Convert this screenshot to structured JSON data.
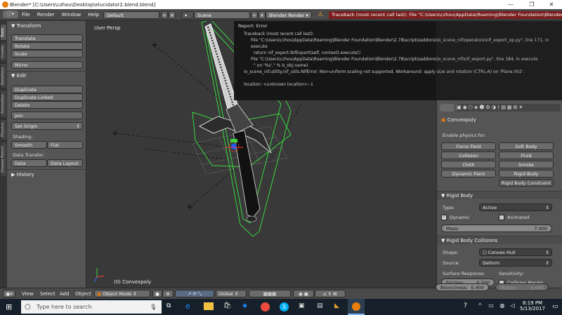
{
  "window": {
    "title": "Blender* [C:\\Users\\czhou\\Desktop\\elucidator2.blend.blend]",
    "min": "—",
    "max": "❐",
    "close": "✕"
  },
  "infobar": {
    "menus": [
      "File",
      "Render",
      "Window",
      "Help"
    ],
    "layout": "Default",
    "scene": "Scene",
    "engine": "Blender Render",
    "error_text": "Traceback (most recent call last):  File \"C:\\Users\\czhou\\AppData\\Roaming\\Blender Foundation\\Blender\\2.78\\sc"
  },
  "shelf_tabs": [
    "Tools",
    "Create",
    "Relations",
    "Animation",
    "Physics",
    "Grease Pencil"
  ],
  "tools": {
    "transform_header": "Transform",
    "translate": "Translate",
    "rotate": "Rotate",
    "scale": "Scale",
    "mirror": "Mirror",
    "edit_header": "Edit",
    "duplicate": "Duplicate",
    "duplicate_linked": "Duplicate Linked",
    "delete": "Delete",
    "join": "Join",
    "set_origin": "Set Origin",
    "shading_label": "Shading:",
    "smooth": "Smooth",
    "flat": "Flat",
    "data_transfer_label": "Data Transfer:",
    "data": "Data",
    "data_layout": "Data Layout",
    "history_header": "History"
  },
  "viewport": {
    "view_label": "User Persp",
    "object_label": "(0) Convexpoly"
  },
  "report": {
    "title": "Report: Error",
    "lines": [
      "Traceback (most recent call last):",
      "File \"C:\\Users\\czhou\\AppData\\Roaming\\Blender Foundation\\Blender\\2.78\\scripts\\addons\\io_scene_nif\\operators\\nif_export_op.py\", line 171, in execute",
      "return nif_export.NifExport(self, context).execute()",
      "File \"C:\\Users\\czhou\\AppData\\Roaming\\Blender Foundation\\Blender\\2.78\\scripts\\addons\\io_scene_nif\\nif_export.py\", line 184, in execute",
      "\" on '%s'.\" % b_obj.name)",
      "io_scene_nif.utility.nif_utils.NifError: Non-uniform scaling not supported. Workaround: apply size and rotation (CTRL-A) on 'Plane.002'.",
      "",
      "location: <unknown location>:-1"
    ]
  },
  "properties": {
    "object_name": "Convexpoly",
    "enable_physics": "Enable physics for:",
    "force_field": "Force Field",
    "soft_body": "Soft Body",
    "collision": "Collision",
    "fluid": "Fluid",
    "cloth": "Cloth",
    "smoke": "Smoke",
    "dynamic_paint": "Dynamic Paint",
    "rigid_body": "Rigid Body",
    "rigid_body_constraint": "Rigid Body Constraint",
    "rb_header": "Rigid Body",
    "type_label": "Type:",
    "type_value": "Active",
    "dynamic": "Dynamic",
    "animated": "Animated",
    "mass_label": "Mass:",
    "mass_value": "7.000",
    "rbc_header": "Rigid Body Collisions",
    "shape_label": "Shape:",
    "shape_value": "Convex Hull",
    "source_label": "Source:",
    "source_value": "Deform",
    "surface_response": "Surface Response:",
    "sensitivity": "Sensitivity:",
    "friction_label": "Friction:",
    "friction_value": "0.500",
    "collision_margin": "Collision Margin",
    "bounciness_label": "Bounciness:",
    "bounciness_value": "0.400",
    "margin_label": "Margin:",
    "margin_value": "0.040"
  },
  "view3d_header": {
    "menus": [
      "View",
      "Select",
      "Add",
      "Object"
    ],
    "mode": "Object Mode",
    "orientation": "Global"
  },
  "taskbar": {
    "search_placeholder": "Type here to search",
    "time": "8:19 PM",
    "date": "5/13/2017"
  },
  "colors": {
    "accent_orange": "#e87d0d",
    "wire_green": "#39d640",
    "error_bg": "#141414"
  }
}
